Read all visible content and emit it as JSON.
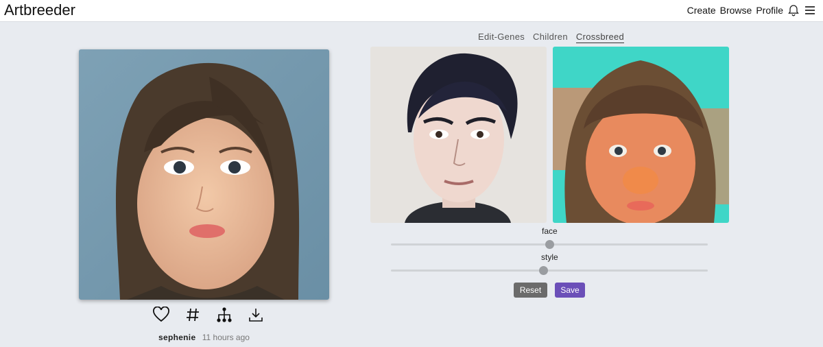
{
  "header": {
    "logo": "Artbreeder",
    "nav": [
      "Create",
      "Browse",
      "Profile"
    ]
  },
  "tabs": [
    {
      "label": "Edit-Genes",
      "active": false
    },
    {
      "label": "Children",
      "active": false
    },
    {
      "label": "Crossbreed",
      "active": true
    }
  ],
  "sliders": [
    {
      "label": "face",
      "value": 0.5
    },
    {
      "label": "style",
      "value": 0.48
    }
  ],
  "buttons": {
    "reset": "Reset",
    "save": "Save"
  },
  "meta": {
    "user": "sephenie",
    "time": "11 hours ago"
  },
  "colors": {
    "accent": "#6b4fb8",
    "background": "#e8ebf0"
  },
  "icons": [
    "heart-icon",
    "hash-icon",
    "tree-icon",
    "download-icon",
    "bell-icon",
    "menu-icon"
  ]
}
